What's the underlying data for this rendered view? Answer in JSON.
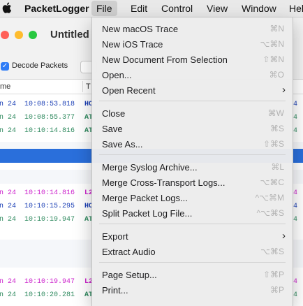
{
  "menubar": {
    "items": [
      {
        "label": "PacketLogger",
        "bold": true
      },
      {
        "label": "File",
        "active": true
      },
      {
        "label": "Edit"
      },
      {
        "label": "Control"
      },
      {
        "label": "View"
      },
      {
        "label": "Window"
      },
      {
        "label": "Help"
      }
    ]
  },
  "window": {
    "title": "Untitled",
    "decode_label": "Decode Packets",
    "columns": {
      "time": "me",
      "type": "T"
    }
  },
  "log_rows": [
    {
      "date": "n 24",
      "time": "10:08:53.818",
      "type": "HC",
      "tail": "4",
      "color": "#1b3fb5"
    },
    {
      "date": "n 24",
      "time": "10:08:55.377",
      "type": "AT",
      "tail": "4",
      "color": "#2f8a5f"
    },
    {
      "date": "n 24",
      "time": "10:10:14.816",
      "type": "AT",
      "tail": "4",
      "color": "#2f8a5f"
    },
    {
      "date": "n 24",
      "time": "10:10:14.816",
      "type": "L2",
      "tail": "4",
      "color": "#cc22cc"
    },
    {
      "date": "n 24",
      "time": "10:10:15.295",
      "type": "HC",
      "tail": "4",
      "color": "#1b3fb5"
    },
    {
      "date": "n 24",
      "time": "10:10:19.947",
      "type": "AT",
      "tail": "4",
      "color": "#2f8a5f"
    },
    {
      "date": "n 24",
      "time": "10:10:19.947",
      "type": "L2",
      "tail": "4",
      "color": "#cc22cc"
    },
    {
      "date": "n 24",
      "time": "10:10:20.281",
      "type": "AT",
      "tail": "4",
      "color": "#2f8a5f"
    }
  ],
  "file_menu": {
    "groups": [
      [
        {
          "label": "New macOS Trace",
          "shortcut": "⌘N"
        },
        {
          "label": "New iOS Trace",
          "shortcut": "⌥⌘N"
        },
        {
          "label": "New Document From Selection",
          "shortcut": "⇧⌘N"
        },
        {
          "label": "Open...",
          "shortcut": "⌘O"
        },
        {
          "label": "Open Recent",
          "submenu": true
        }
      ],
      [
        {
          "label": "Close",
          "shortcut": "⌘W"
        },
        {
          "label": "Save",
          "shortcut": "⌘S"
        },
        {
          "label": "Save As...",
          "shortcut": "⇧⌘S"
        }
      ],
      [
        {
          "label": "Merge Syslog Archive...",
          "shortcut": "⌘L"
        },
        {
          "label": "Merge Cross-Transport Logs...",
          "shortcut": "⌥⌘C"
        },
        {
          "label": "Merge Packet Logs...",
          "shortcut": "^⌥⌘M"
        },
        {
          "label": "Split Packet Log File...",
          "shortcut": "^⌥⌘S"
        }
      ],
      [
        {
          "label": "Export",
          "submenu": true
        },
        {
          "label": "Extract Audio",
          "shortcut": "⌥⌘S"
        }
      ],
      [
        {
          "label": "Page Setup...",
          "shortcut": "⇧⌘P"
        },
        {
          "label": "Print...",
          "shortcut": "⌘P"
        }
      ]
    ]
  },
  "colors": {
    "highlight": "#2a6fdb",
    "close": "#ff5f57",
    "minimize": "#febc2e",
    "zoom": "#28c840",
    "accent": "#2f7cf6"
  }
}
